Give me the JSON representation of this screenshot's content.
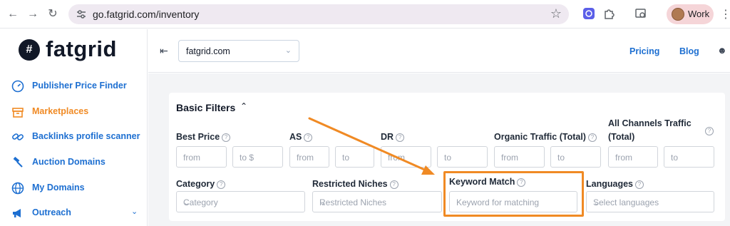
{
  "browser": {
    "url": "go.fatgrid.com/inventory",
    "profile_label": "Work",
    "icons": [
      "back-arrow-icon",
      "forward-arrow-icon",
      "reload-icon",
      "tune-icon",
      "star-icon",
      "extension-icon",
      "puzzle-icon",
      "tab-search-icon",
      "menu-dots-icon"
    ]
  },
  "brand": {
    "logo_mark": "#",
    "name": "fatgrid"
  },
  "sidebar": {
    "items": [
      {
        "label": "Publisher Price Finder",
        "icon": "gauge-icon",
        "active": false
      },
      {
        "label": "Marketplaces",
        "icon": "store-icon",
        "active": true
      },
      {
        "label": "Backlinks profile scanner",
        "icon": "link-icon",
        "active": false
      },
      {
        "label": "Auction Domains",
        "icon": "gavel-icon",
        "active": false
      },
      {
        "label": "My Domains",
        "icon": "globe-icon",
        "active": false
      },
      {
        "label": "Outreach",
        "icon": "megaphone-icon",
        "active": false
      }
    ]
  },
  "header": {
    "domain_select": "fatgrid.com",
    "pricing": "Pricing",
    "blog": "Blog"
  },
  "filters": {
    "title": "Basic Filters",
    "best_price": {
      "label": "Best Price",
      "from": "from",
      "to": "to $"
    },
    "as": {
      "label": "AS",
      "from": "from",
      "to": "to"
    },
    "dr": {
      "label": "DR",
      "from": "from",
      "to": "to"
    },
    "organic": {
      "label": "Organic Traffic (Total)",
      "from": "from",
      "to": "to"
    },
    "all_channels": {
      "label_line1": "All Channels Traffic",
      "label_line2": "(Total)",
      "from": "from",
      "to": "to"
    },
    "category": {
      "label": "Category",
      "placeholder": "Category"
    },
    "restricted": {
      "label": "Restricted Niches",
      "placeholder": "Restricted Niches"
    },
    "keyword": {
      "label": "Keyword Match",
      "placeholder": "Keyword for matching"
    },
    "languages": {
      "label": "Languages",
      "placeholder": "Select languages"
    }
  },
  "colors": {
    "accent_blue": "#1d6fd1",
    "accent_orange": "#f08a24",
    "annotation": "#f08a24"
  }
}
